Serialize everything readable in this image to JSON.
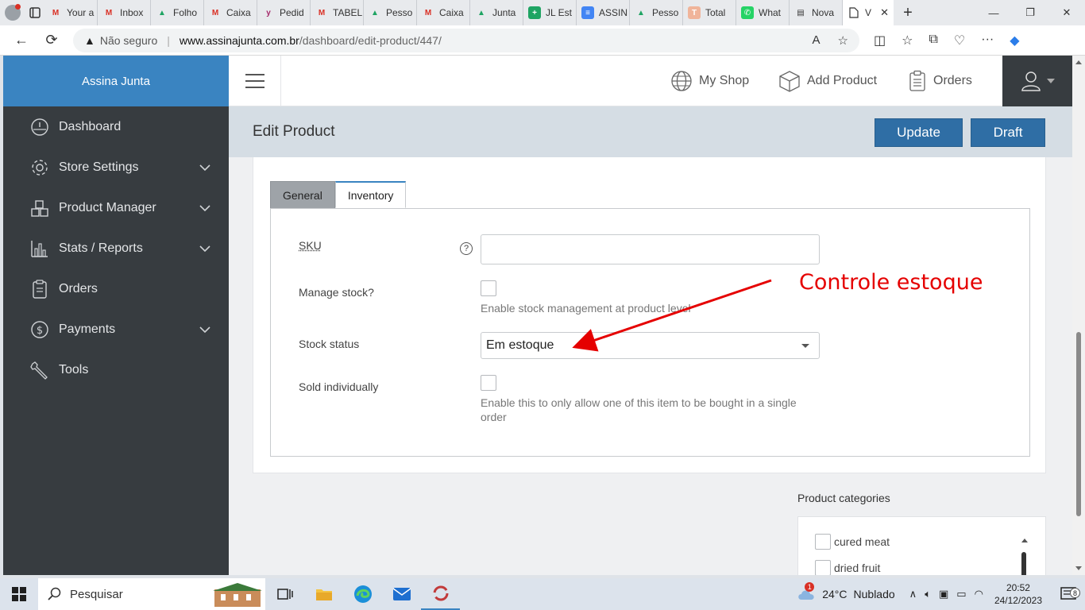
{
  "browser": {
    "tabs": [
      {
        "label": "Your a",
        "icon": "gmail"
      },
      {
        "label": "Inbox",
        "icon": "gmail"
      },
      {
        "label": "Folho",
        "icon": "drive"
      },
      {
        "label": "Caixa",
        "icon": "gmail"
      },
      {
        "label": "Pedid",
        "icon": "yoast"
      },
      {
        "label": "TABEL",
        "icon": "gmail"
      },
      {
        "label": "Pesso",
        "icon": "drive"
      },
      {
        "label": "Caixa",
        "icon": "gmail"
      },
      {
        "label": "Junta",
        "icon": "drive"
      },
      {
        "label": "JL Est",
        "icon": "sheets"
      },
      {
        "label": "ASSIN",
        "icon": "docs"
      },
      {
        "label": "Pesso",
        "icon": "drive"
      },
      {
        "label": "Total",
        "icon": "total"
      },
      {
        "label": "What",
        "icon": "whatsapp"
      },
      {
        "label": "Nova",
        "icon": "newtab"
      }
    ],
    "active_tab_label": "V",
    "url_warning": "Não seguro",
    "url_host": "www.assinajunta.com.br",
    "url_path": "/dashboard/edit-product/447/"
  },
  "sidebar": {
    "brand": "Assina Junta",
    "items": [
      {
        "label": "Dashboard",
        "icon": "dashboard-icon",
        "has_submenu": false
      },
      {
        "label": "Store Settings",
        "icon": "gear-icon",
        "has_submenu": true
      },
      {
        "label": "Product Manager",
        "icon": "boxes-icon",
        "has_submenu": true
      },
      {
        "label": "Stats / Reports",
        "icon": "bar-chart-icon",
        "has_submenu": true
      },
      {
        "label": "Orders",
        "icon": "clipboard-icon",
        "has_submenu": false
      },
      {
        "label": "Payments",
        "icon": "dollar-icon",
        "has_submenu": true
      },
      {
        "label": "Tools",
        "icon": "wrench-icon",
        "has_submenu": false
      }
    ]
  },
  "topnav": {
    "my_shop": "My Shop",
    "add_product": "Add Product",
    "orders": "Orders"
  },
  "page": {
    "title": "Edit Product",
    "update_label": "Update",
    "draft_label": "Draft"
  },
  "product_tabs": {
    "general": "General",
    "inventory": "Inventory",
    "active": "Inventory"
  },
  "inventory": {
    "sku_label": "SKU",
    "sku_value": "",
    "manage_stock_label": "Manage stock?",
    "manage_stock_checked": false,
    "manage_stock_hint": "Enable stock management at product level",
    "stock_status_label": "Stock status",
    "stock_status_value": "Em estoque",
    "sold_individually_label": "Sold individually",
    "sold_individually_checked": false,
    "sold_individually_hint_line1": "Enable this to only allow one of this item to be bought in a single",
    "sold_individually_hint_line2": "order"
  },
  "annotation": {
    "text": "Controle estoque",
    "color": "#e50000"
  },
  "categories": {
    "label": "Product categories",
    "items": [
      {
        "label": "cured meat",
        "checked": false
      },
      {
        "label": "dried fruit",
        "checked": false
      }
    ]
  },
  "taskbar": {
    "search_placeholder": "Pesquisar",
    "weather_temp": "24°C",
    "weather_desc": "Nublado",
    "weather_badge": "1",
    "time": "20:52",
    "date": "24/12/2023",
    "notification_count": "8"
  },
  "colors": {
    "brand_blue": "#3a84c1",
    "sidebar_bg": "#373c40",
    "button_blue": "#2f6ea5",
    "title_bar": "#d5dde4"
  }
}
